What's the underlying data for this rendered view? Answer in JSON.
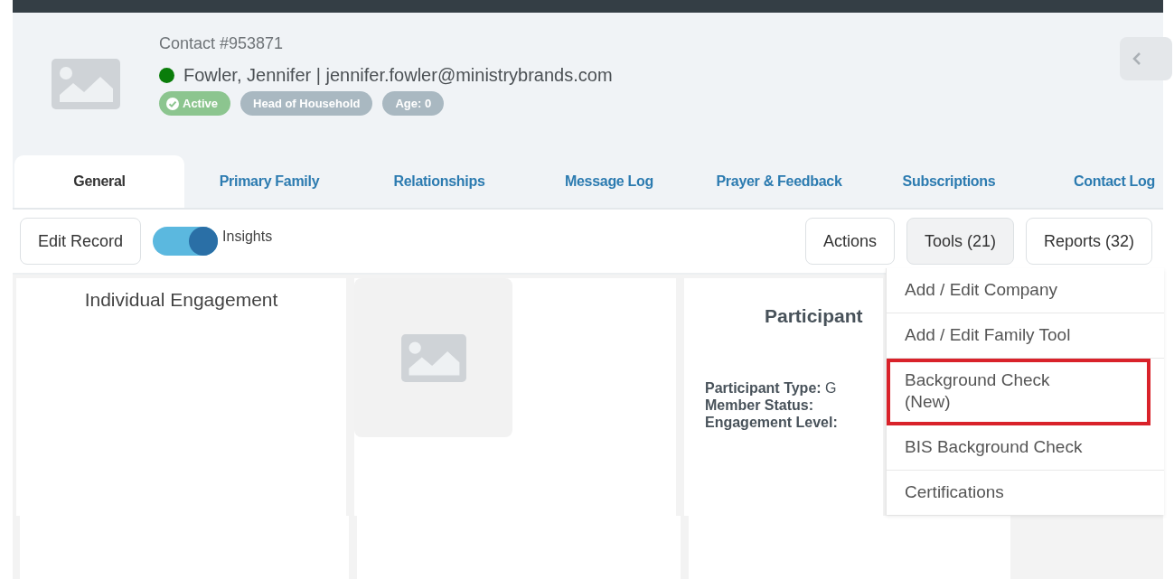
{
  "contact": {
    "number": "Contact #953871",
    "online": true,
    "name_line": "Fowler, Jennifer | jennifer.fowler@ministrybrands.com",
    "badges": [
      {
        "label": "Active",
        "kind": "status",
        "color": "#8cc58f"
      },
      {
        "label": "Head of Household",
        "kind": "plain",
        "color": "#a9b8c1"
      },
      {
        "label": "Age: 0",
        "kind": "plain",
        "color": "#a9b8c1"
      }
    ]
  },
  "tabs": [
    {
      "label": "General",
      "selected": true
    },
    {
      "label": "Primary Family",
      "selected": false
    },
    {
      "label": "Relationships",
      "selected": false
    },
    {
      "label": "Message Log",
      "selected": false
    },
    {
      "label": "Prayer & Feedback",
      "selected": false
    },
    {
      "label": "Subscriptions",
      "selected": false
    },
    {
      "label": "Contact Log",
      "selected": false
    }
  ],
  "toolbar": {
    "edit_button": "Edit Record",
    "insights": {
      "label": "Insights",
      "on": true
    },
    "buttons": [
      {
        "label": "Actions",
        "expanded": false
      },
      {
        "label": "Tools (21)",
        "expanded": true
      },
      {
        "label": "Reports (32)",
        "expanded": false
      }
    ]
  },
  "panels": [
    {
      "title": "Individual Engagement"
    },
    {
      "kind": "picture"
    },
    {
      "title": "Participant",
      "fields": [
        {
          "label": "Participant Type:",
          "value": "G"
        },
        {
          "label": "Member Status:"
        },
        {
          "label": "Engagement Level:"
        }
      ]
    }
  ],
  "tools_menu": [
    {
      "label": "Add / Edit Company",
      "annotated": false
    },
    {
      "label": "Add / Edit Family Tool",
      "annotated": false
    },
    {
      "label": "Background Check\n(New)",
      "annotated": true
    },
    {
      "label": "BIS Background Check",
      "annotated": false
    },
    {
      "label": "Certifications",
      "annotated": false
    }
  ]
}
